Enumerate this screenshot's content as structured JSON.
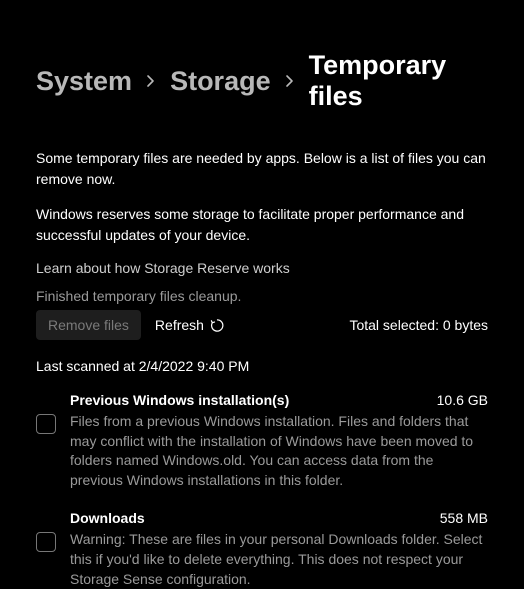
{
  "breadcrumb": {
    "system": "System",
    "storage": "Storage",
    "current": "Temporary files"
  },
  "intro1": "Some temporary files are needed by apps. Below is a list of files you can remove now.",
  "intro2": "Windows reserves some storage to facilitate proper performance and successful updates of your device.",
  "learn_link": "Learn about how Storage Reserve works",
  "cleanup_status": "Finished temporary files cleanup.",
  "remove_btn": "Remove files",
  "refresh_btn": "Refresh",
  "total_selected": "Total selected: 0 bytes",
  "last_scan": "Last scanned at 2/4/2022 9:40 PM",
  "items": [
    {
      "title": "Previous Windows installation(s)",
      "size": "10.6 GB",
      "desc": "Files from a previous Windows installation.  Files and folders that may conflict with the installation of Windows have been moved to folders named Windows.old.  You can access data from the previous Windows installations in this folder."
    },
    {
      "title": "Downloads",
      "size": "558 MB",
      "desc": "Warning: These are files in your personal Downloads folder. Select this if you'd like to delete everything. This does not respect your Storage Sense configuration."
    }
  ]
}
